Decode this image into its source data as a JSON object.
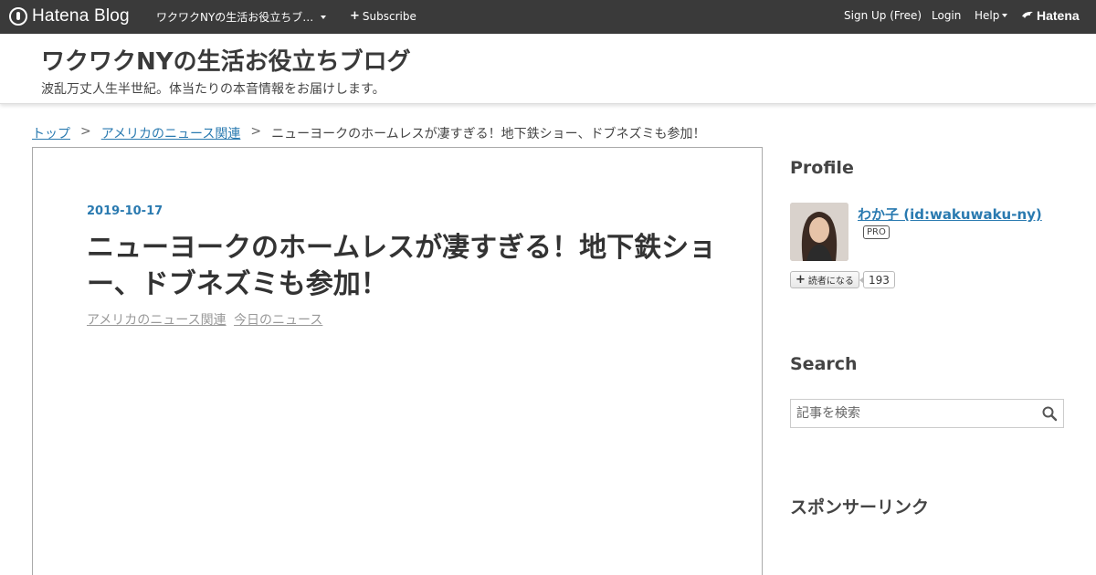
{
  "topbar": {
    "logo_text": "Hatena Blog",
    "blog_switch": "ワクワクNYの生活お役立ちブ…",
    "subscribe": "Subscribe",
    "signup": "Sign Up (Free)",
    "login": "Login",
    "help": "Help",
    "hatena": "Hatena"
  },
  "header": {
    "title": "ワクワクNYの生活お役立ちブログ",
    "description": "波乱万丈人生半世紀。体当たりの本音情報をお届けします。"
  },
  "breadcrumb": {
    "items": [
      "トップ",
      "アメリカのニュース関連",
      "ニューヨークのホームレスが凄すぎる！地下鉄ショー、ドブネズミも参加！"
    ],
    "separator": ">"
  },
  "article": {
    "date": "2019-10-17",
    "title": "ニューヨークのホームレスが凄すぎる！地下鉄ショー、ドブネズミも参加！",
    "categories": [
      "アメリカのニュース関連",
      "今日のニュース"
    ]
  },
  "sidebar": {
    "profile_title": "Profile",
    "profile_name": "わか子 (id:wakuwaku-ny)",
    "pro_badge": "PRO",
    "reader_button": "読者になる",
    "reader_count": "193",
    "search_title": "Search",
    "search_placeholder": "記事を検索",
    "sponsor_title": "スポンサーリンク"
  },
  "colors": {
    "topbar_bg": "#3a3a3a",
    "link": "#2a7ab0"
  }
}
